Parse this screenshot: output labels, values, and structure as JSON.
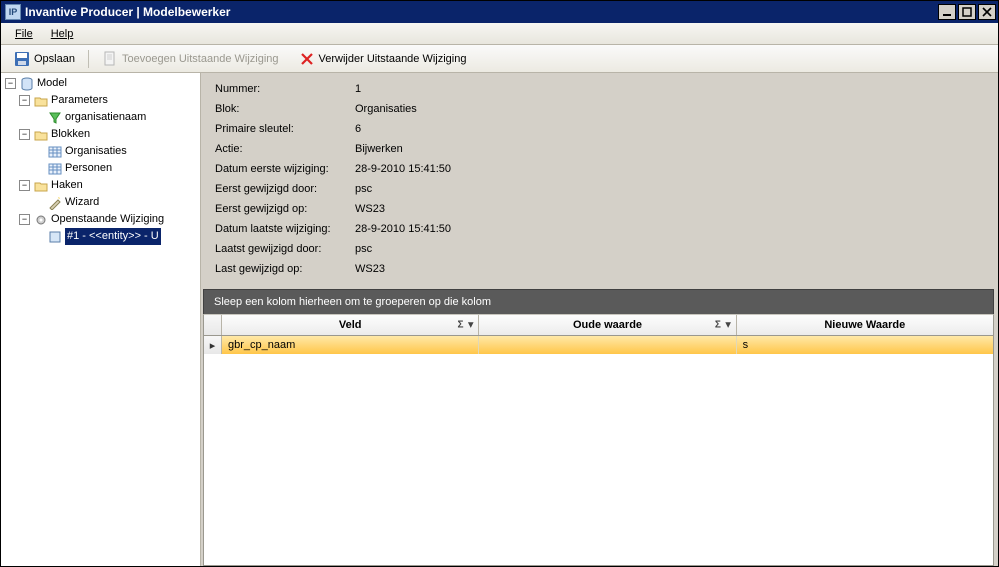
{
  "window": {
    "title": "Invantive Producer | Modelbewerker"
  },
  "menu": {
    "file": "File",
    "help": "Help"
  },
  "toolbar": {
    "save": "Opslaan",
    "add_pending": "Toevoegen Uitstaande Wijziging",
    "delete_pending": "Verwijder Uitstaande Wijziging"
  },
  "tree": {
    "root": "Model",
    "parameters": "Parameters",
    "param_items": [
      "organisatienaam"
    ],
    "blocks": "Blokken",
    "block_items": [
      "Organisaties",
      "Personen"
    ],
    "hooks": "Haken",
    "hook_items": [
      "Wizard"
    ],
    "pending": "Openstaande Wijziging",
    "pending_items": [
      "#1 - <<entity>> - U"
    ]
  },
  "details": {
    "labels": {
      "number": "Nummer:",
      "block": "Blok:",
      "primary_key": "Primaire sleutel:",
      "action": "Actie:",
      "date_first_change": "Datum eerste wijziging:",
      "first_changed_by": "Eerst gewijzigd door:",
      "first_changed_on": "Eerst gewijzigd op:",
      "date_last_change": "Datum laatste wijziging:",
      "last_changed_by": "Laatst gewijzigd door:",
      "last_changed_on": "Last gewijzigd op:"
    },
    "values": {
      "number": "1",
      "block": "Organisaties",
      "primary_key": "6",
      "action": "Bijwerken",
      "date_first_change": "28-9-2010 15:41:50",
      "first_changed_by": "psc",
      "first_changed_on": "WS23",
      "date_last_change": "28-9-2010 15:41:50",
      "last_changed_by": "psc",
      "last_changed_on": "WS23"
    }
  },
  "grid": {
    "group_hint": "Sleep een kolom hierheen om te groeperen op die kolom",
    "columns": {
      "field": "Veld",
      "old_value": "Oude waarde",
      "new_value": "Nieuwe Waarde"
    },
    "rows": [
      {
        "field": "gbr_cp_naam",
        "old_value": "",
        "new_value": "s"
      }
    ]
  }
}
